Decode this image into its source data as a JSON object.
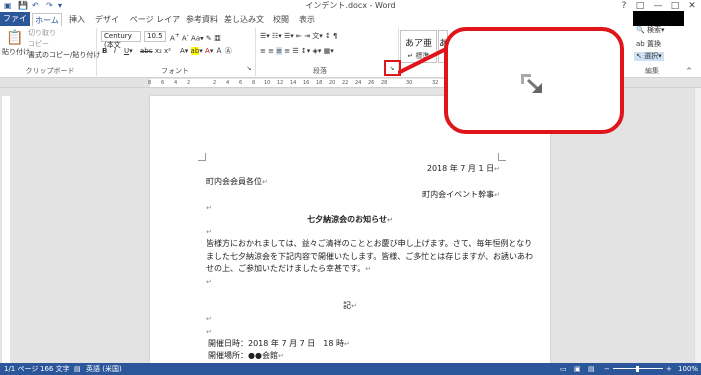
{
  "window": {
    "title": "インデント.docx - Word",
    "controls": [
      "?",
      "□",
      "—",
      "□",
      "✕"
    ]
  },
  "quick_access": {
    "save": "💾",
    "undo": "↶",
    "redo": "↷",
    "customize": "▾"
  },
  "tabs": [
    "ファイル",
    "ホーム",
    "挿入",
    "デザイン",
    "ページ レイアウト",
    "参考資料",
    "差し込み文書",
    "校閲",
    "表示"
  ],
  "ribbon": {
    "clipboard": {
      "paste": "貼り付け",
      "cut": "切り取り",
      "copy": "コピー",
      "format_painter": "書式のコピー/貼り付け",
      "label": "クリップボード"
    },
    "font": {
      "font_name": "Century (本文",
      "font_size": "10.5",
      "label": "フォント"
    },
    "paragraph": {
      "label": "段落"
    },
    "styles": {
      "style1_sample": "あア亜",
      "style1_name": "↵ 標準",
      "style2_sample": "あ"
    },
    "editing": {
      "find": "検索",
      "replace": "置換",
      "select": "選択",
      "label": "編集"
    }
  },
  "ruler": {
    "ticks": [
      "8",
      "6",
      "4",
      "2",
      "",
      "2",
      "4",
      "6",
      "8",
      "10",
      "12",
      "14",
      "16",
      "18",
      "20",
      "22",
      "24",
      "26",
      "28",
      "30",
      "32"
    ]
  },
  "document": {
    "date": "2018 年 7 月 1 日",
    "recipient": "町内会会員各位",
    "sender": "町内会イベント幹事",
    "title": "七夕納涼会のお知らせ",
    "body1": "皆様方におかれましては、益々ご清祥のこととお慶び申し上げます。さて、毎年恒例となり",
    "body2": "ました七夕納涼会を下記内容で開催いたします。皆様、ご多忙とは存じますが、お誘いあわ",
    "body3": "せの上、ご参加いただけましたら幸甚です。",
    "ki": "記",
    "datetime": "開催日時：2018 年 7 月 7 日　18 時",
    "place": "開催場所：●●会館",
    "para_mark": "↵"
  },
  "status": {
    "page": "1/1 ページ",
    "words": "166 文字",
    "lang": "英語 (米国)",
    "zoom": "100%",
    "zoom_minus": "−",
    "zoom_plus": "+"
  },
  "callout": {
    "icon": "dialog-launcher-icon"
  },
  "colors": {
    "word_blue": "#2b579a",
    "highlight_red": "#e0141b"
  }
}
